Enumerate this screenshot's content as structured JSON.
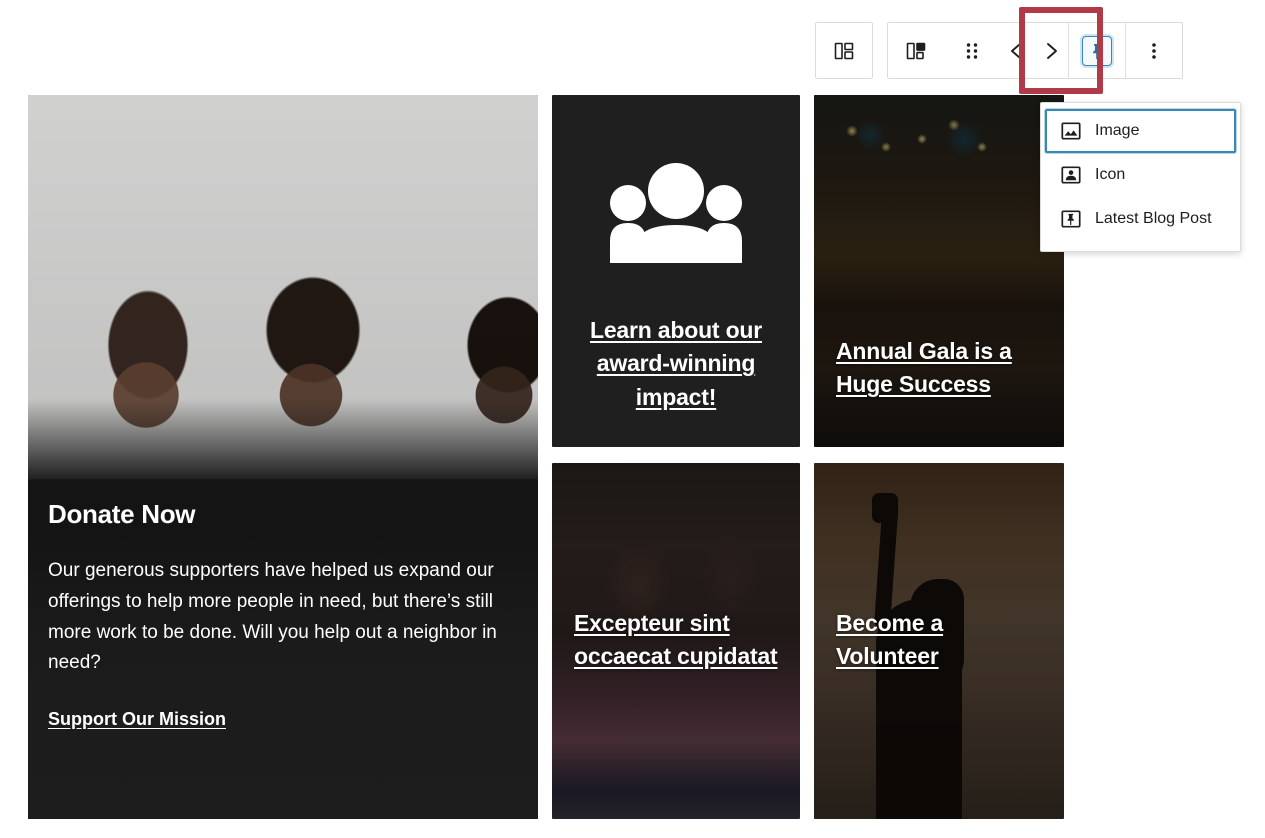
{
  "toolbar": {
    "block_inserter": {
      "icon": "block-layout-icon",
      "label": "Block"
    },
    "block_type": {
      "icon": "block-type-icon",
      "label": "Change block type"
    },
    "drag_handle": {
      "icon": "drag-handle-icon",
      "label": "Drag"
    },
    "move_up": {
      "icon": "chevron-left-icon",
      "label": "Move left"
    },
    "move_down": {
      "icon": "chevron-right-icon",
      "label": "Move right"
    },
    "pin_button": {
      "icon": "pin-icon",
      "label": "Latest Blog Post",
      "selected": true
    },
    "more_options": {
      "icon": "more-vertical-icon",
      "label": "Options"
    }
  },
  "annotation": {
    "color": "#b03a48",
    "target": "pin-button"
  },
  "dropdown": {
    "selected": "Image",
    "items": [
      {
        "label": "Image",
        "icon": "image-icon",
        "selected": true
      },
      {
        "label": "Icon",
        "icon": "person-icon",
        "selected": false
      },
      {
        "label": "Latest Blog Post",
        "icon": "pin-icon",
        "selected": false
      }
    ]
  },
  "cards": {
    "donate": {
      "title": "Donate Now",
      "body": "Our generous supporters have helped us expand our offerings to help more people in need, but there’s still more work to be done. Will you help out a neighbor in need?",
      "link": "Support Our Mission",
      "image_alt": "three-women-seated-talking"
    },
    "impact": {
      "icon": "people-group-icon",
      "link": "Learn about our award-winning impact!",
      "background": "#1f1f1f"
    },
    "gala": {
      "link": "Annual Gala is a Huge Success",
      "image_alt": "string-lights-indoor-venue"
    },
    "excepteur": {
      "link": "Excepteur sint occaecat cupidatat",
      "image_alt": "two-women-at-table-with-coffee"
    },
    "volunteer": {
      "link": "Become a Volunteer",
      "image_alt": "silhouette-raised-fist"
    }
  },
  "colors": {
    "accent_blue": "#3a86b5",
    "annotation_red": "#b03a48",
    "dark_card": "#1f1f1f",
    "text_dark": "#1e1e1e",
    "page_bg": "#ffffff"
  }
}
